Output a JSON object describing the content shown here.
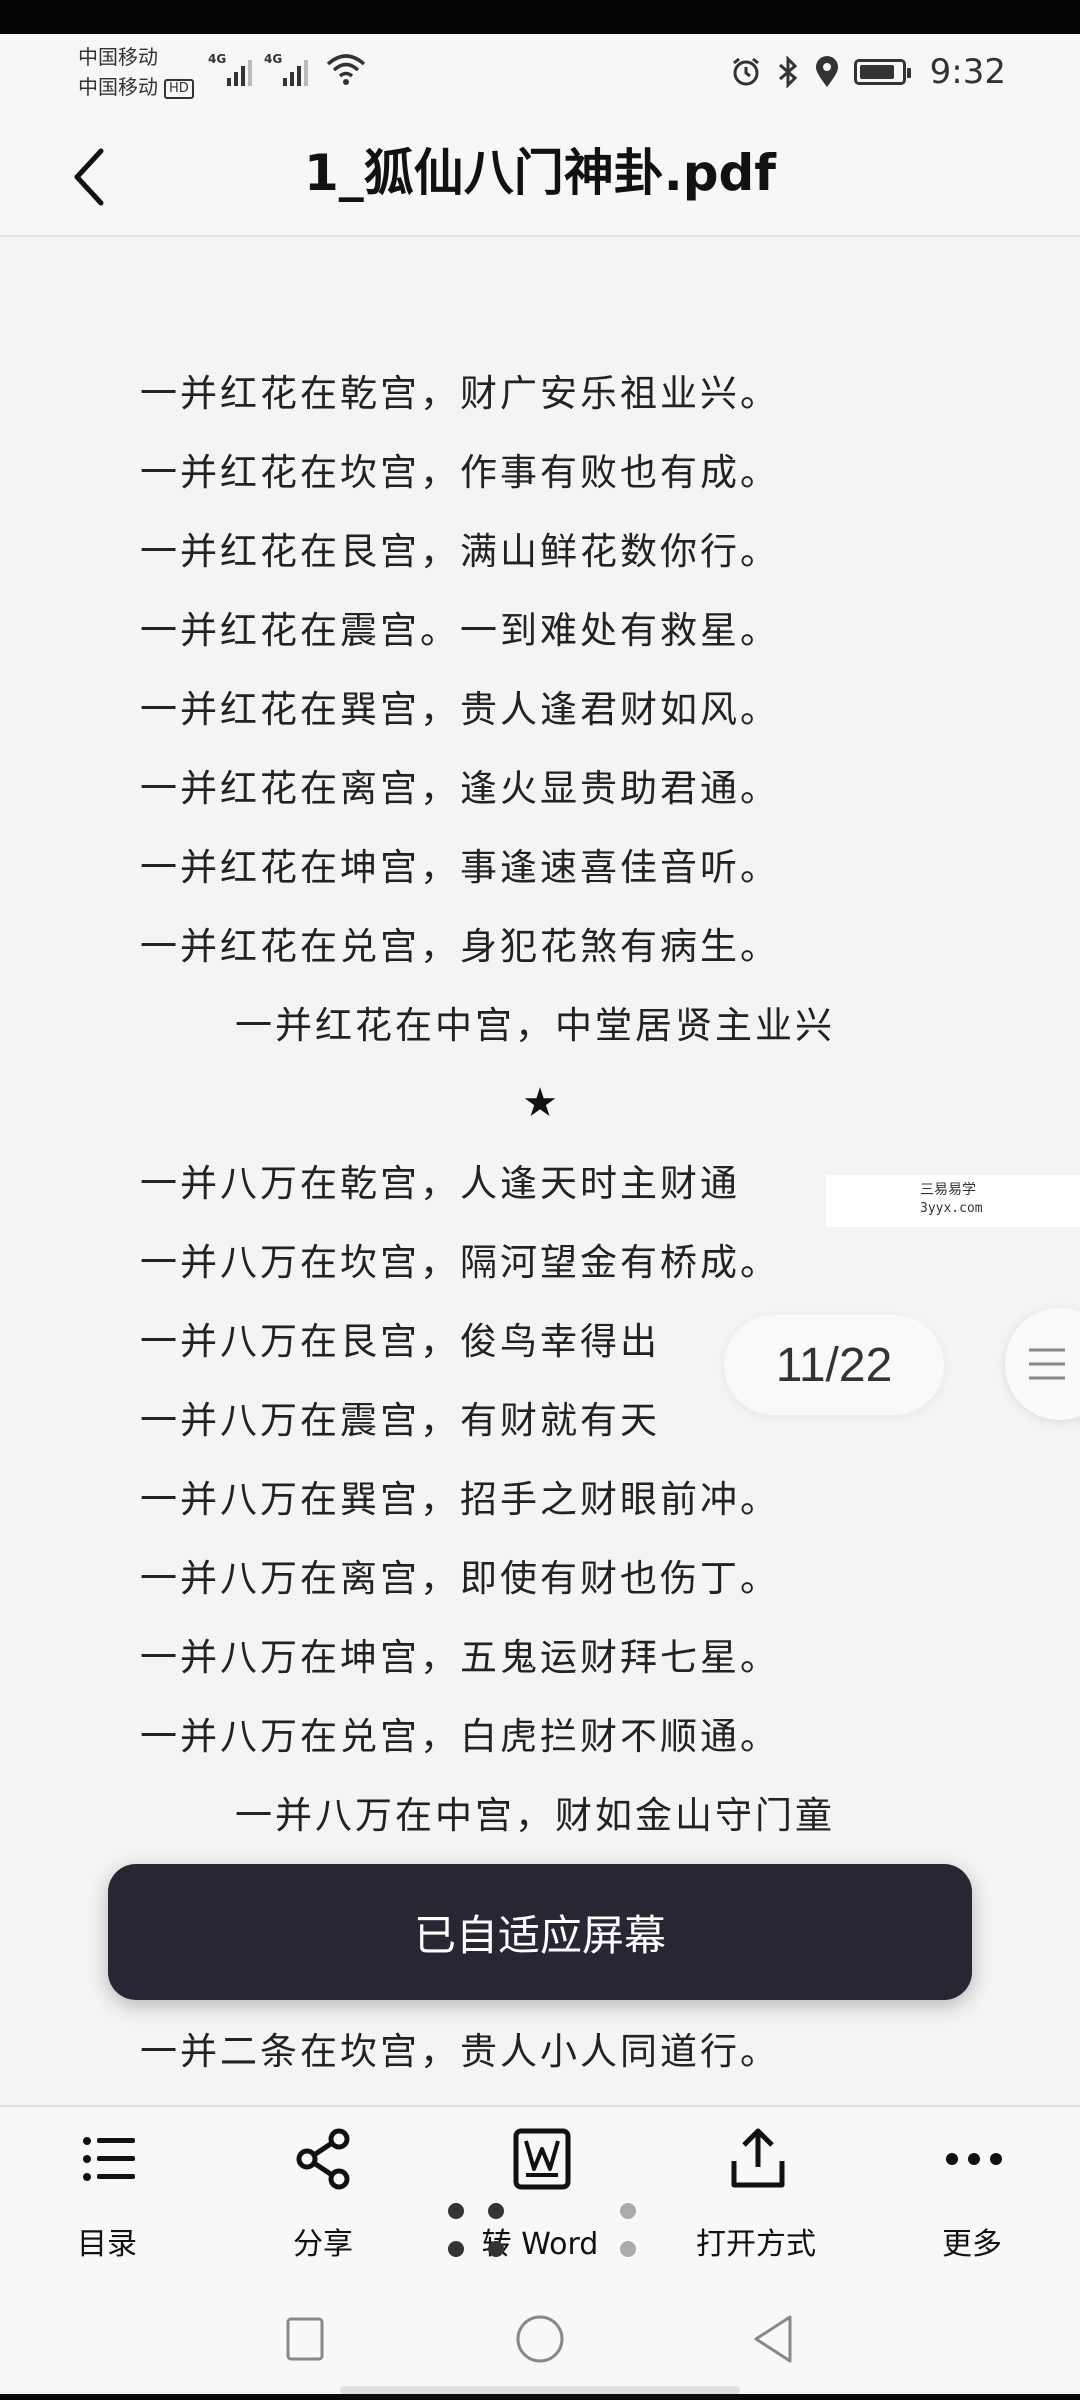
{
  "status_bar": {
    "carrier_1": "中国移动",
    "carrier_2": "中国移动",
    "hd_badge": "HD",
    "sim1_network": "4G",
    "sim2_network": "4G",
    "time": "9:32",
    "battery_level": 0.85
  },
  "header": {
    "title": "1_狐仙八门神卦.pdf",
    "back_icon": "chevron-left-icon"
  },
  "document": {
    "lines": [
      "一并红花在乾宫，财广安乐祖业兴。",
      "一并红花在坎宫，作事有败也有成。",
      "一并红花在艮宫，满山鲜花数你行。",
      "一并红花在震宫。一到难处有救星。",
      "一并红花在巽宫，贵人逢君财如风。",
      "一并红花在离宫，逢火显贵助君通。",
      "一并红花在坤宫，事逢速喜佳音听。",
      "一并红花在兑宫，身犯花煞有病生。",
      "一并红花在中宫，中堂居贤主业兴",
      "★",
      "一并八万在乾宫，人逢天时主财通",
      "一并八万在坎宫，隔河望金有桥成。",
      "一并八万在艮宫，俊鸟幸得出",
      "一并八万在震宫，有财就有天",
      "一并八万在巽宫，招手之财眼前冲。",
      "一并八万在离宫，即使有财也伤丁。",
      "一并八万在坤宫，五鬼运财拜七星。",
      "一并八万在兑宫，白虎拦财不顺通。",
      "一并八万在中宫，财如金山守门童",
      "一并二条在坎宫，贵人小人同道行。"
    ],
    "watermark": {
      "name": "三易易学",
      "site": "3yyx.com"
    }
  },
  "page_indicator": {
    "current": "11",
    "total": "22",
    "text": "11/22"
  },
  "toast": {
    "message": "已自适应屏幕"
  },
  "toolbar": {
    "items": [
      {
        "label": "目录",
        "icon": "list-icon"
      },
      {
        "label": "分享",
        "icon": "share-icon"
      },
      {
        "label": "转 Word",
        "icon": "word-convert-icon"
      },
      {
        "label": "打开方式",
        "icon": "open-with-icon"
      },
      {
        "label": "更多",
        "icon": "more-icon"
      }
    ]
  },
  "colors": {
    "toast_bg": "#272633",
    "page_bg": "#f4f4f4",
    "text": "#222222"
  }
}
